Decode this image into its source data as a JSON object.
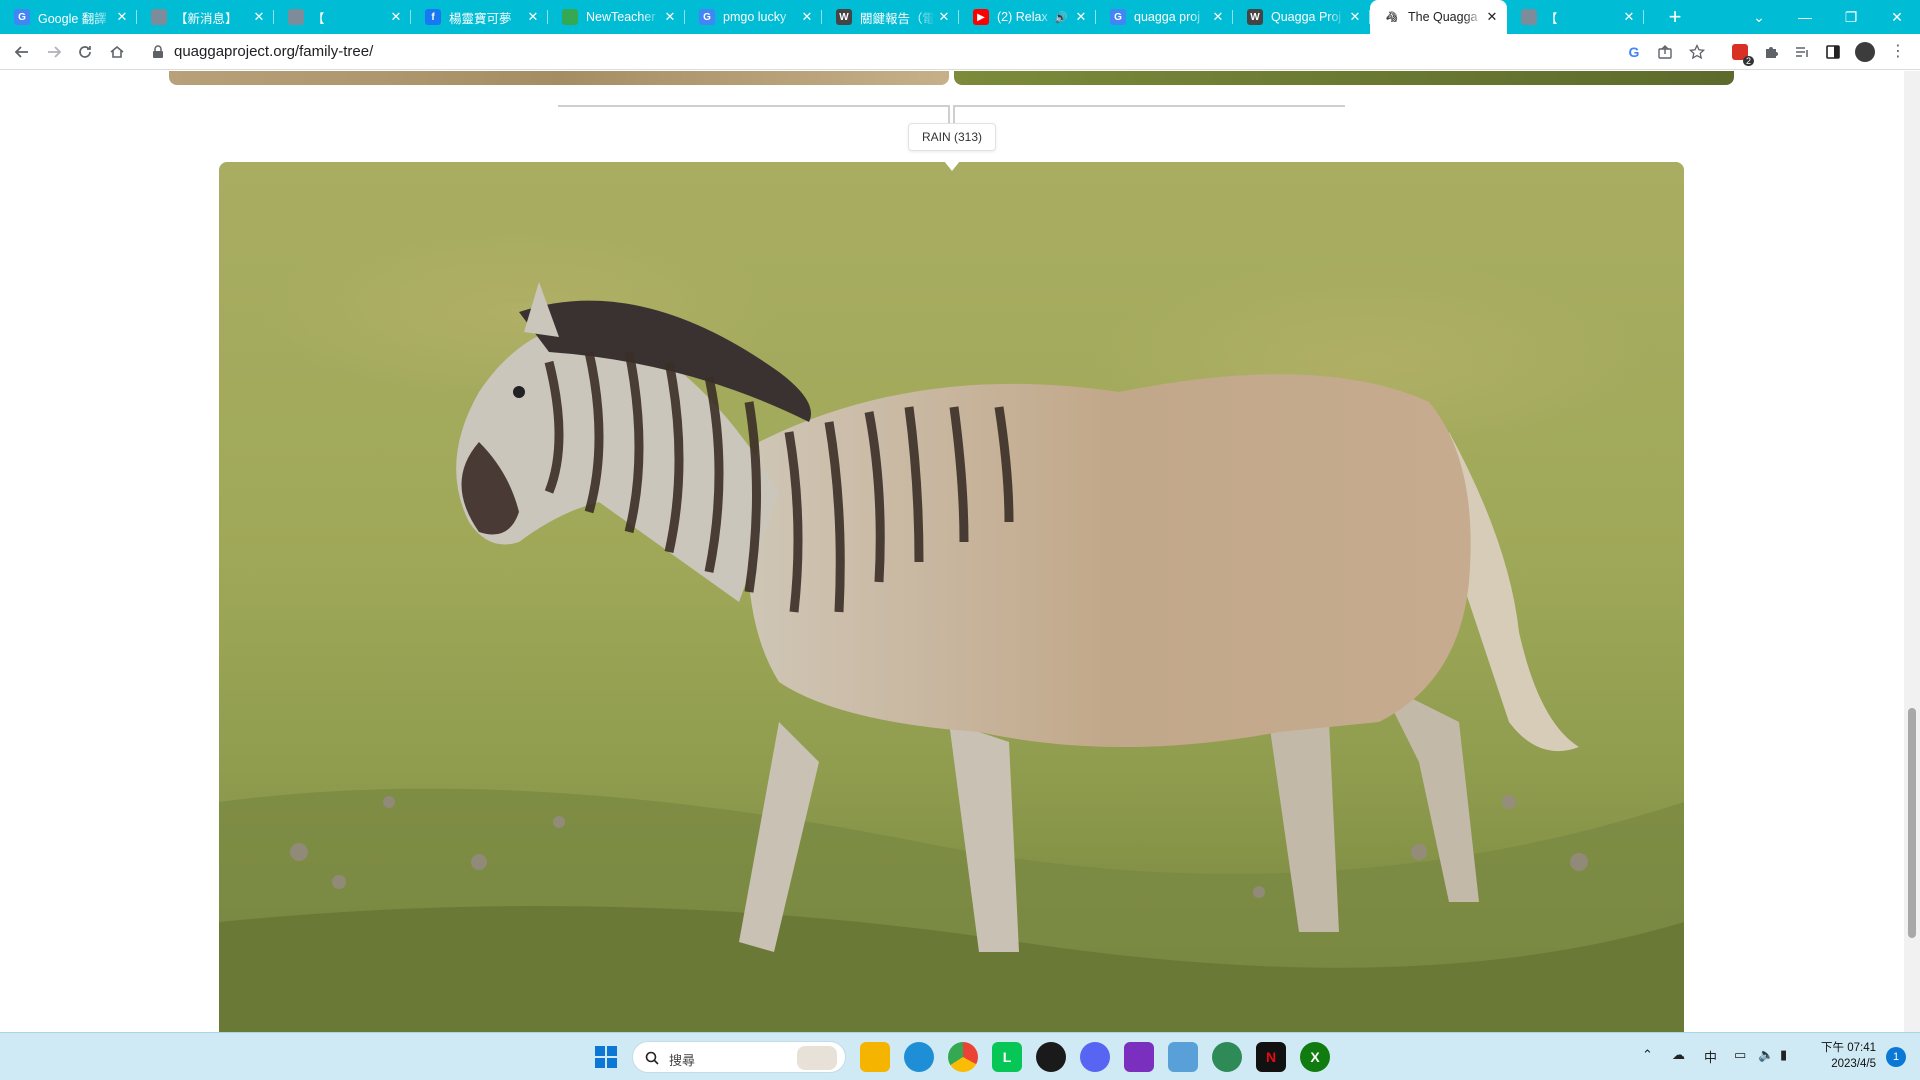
{
  "browser": {
    "tabs": [
      {
        "title": "Google 翻譯",
        "fav": "G",
        "color": "#4285f4",
        "active": false
      },
      {
        "title": "【新消息】",
        "fav": "",
        "color": "#7d8c9a",
        "active": false
      },
      {
        "title": "【",
        "fav": "",
        "color": "#7d8c9a",
        "active": false
      },
      {
        "title": "楊靈寶可夢",
        "fav": "f",
        "color": "#1877f2",
        "active": false
      },
      {
        "title": "NewTeacher",
        "fav": "",
        "color": "#34a853",
        "active": false
      },
      {
        "title": "pmgo lucky",
        "fav": "G",
        "color": "#4285f4",
        "active": false
      },
      {
        "title": "關鍵報告（電",
        "fav": "W",
        "color": "#444444",
        "active": false
      },
      {
        "title": "(2) Relax",
        "fav": "▶",
        "color": "#ff0000",
        "active": false,
        "audio": true
      },
      {
        "title": "quagga proj",
        "fav": "G",
        "color": "#4285f4",
        "active": false
      },
      {
        "title": "Quagga Proj",
        "fav": "W",
        "color": "#444444",
        "active": false
      },
      {
        "title": "The Quagga",
        "fav": "🦓",
        "color": "#ffffff",
        "active": true
      },
      {
        "title": "【",
        "fav": "",
        "color": "#7d8c9a",
        "active": false
      }
    ],
    "url": "quaggaproject.org/family-tree/",
    "new_tab": "+",
    "win_min": "—",
    "win_max": "❐",
    "win_close": "✕",
    "ext_badge": "2"
  },
  "page": {
    "node_label": "RAIN (313)"
  },
  "taskbar": {
    "search_placeholder": "搜尋",
    "ime": "中",
    "time": "下午 07:41",
    "date": "2023/4/5",
    "notif_count": "1"
  },
  "colors": {
    "tabstrip": "#00bcd4",
    "taskbar": "#cfeaf5"
  }
}
